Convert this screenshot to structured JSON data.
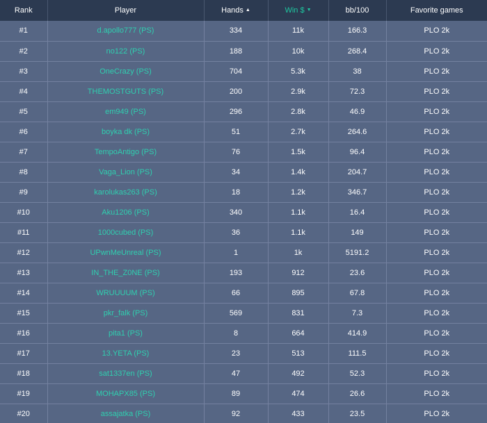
{
  "header": {
    "rank": "Rank",
    "player": "Player",
    "hands": "Hands",
    "hands_sort_icon": "▲",
    "win": "Win $",
    "win_sort_icon": "▼",
    "bb100": "bb/100",
    "favorite_games": "Favorite games"
  },
  "colors": {
    "header_bg": "#2c3a51",
    "row_bg": "#566684",
    "accent": "#1ec8a0",
    "link": "#2fd0b0"
  },
  "rows": [
    {
      "rank": "#1",
      "player": "d.apollo777 (PS)",
      "hands": "334",
      "win": "11k",
      "bb100": "166.3",
      "game": "PLO 2k"
    },
    {
      "rank": "#2",
      "player": "no122 (PS)",
      "hands": "188",
      "win": "10k",
      "bb100": "268.4",
      "game": "PLO 2k"
    },
    {
      "rank": "#3",
      "player": "OneCrazy (PS)",
      "hands": "704",
      "win": "5.3k",
      "bb100": "38",
      "game": "PLO 2k"
    },
    {
      "rank": "#4",
      "player": "THEMOSTGUTS (PS)",
      "hands": "200",
      "win": "2.9k",
      "bb100": "72.3",
      "game": "PLO 2k"
    },
    {
      "rank": "#5",
      "player": "em949 (PS)",
      "hands": "296",
      "win": "2.8k",
      "bb100": "46.9",
      "game": "PLO 2k"
    },
    {
      "rank": "#6",
      "player": "boyka dk (PS)",
      "hands": "51",
      "win": "2.7k",
      "bb100": "264.6",
      "game": "PLO 2k"
    },
    {
      "rank": "#7",
      "player": "TempoAntigo (PS)",
      "hands": "76",
      "win": "1.5k",
      "bb100": "96.4",
      "game": "PLO 2k"
    },
    {
      "rank": "#8",
      "player": "Vaga_Lion (PS)",
      "hands": "34",
      "win": "1.4k",
      "bb100": "204.7",
      "game": "PLO 2k"
    },
    {
      "rank": "#9",
      "player": "karolukas263 (PS)",
      "hands": "18",
      "win": "1.2k",
      "bb100": "346.7",
      "game": "PLO 2k"
    },
    {
      "rank": "#10",
      "player": "Aku1206 (PS)",
      "hands": "340",
      "win": "1.1k",
      "bb100": "16.4",
      "game": "PLO 2k"
    },
    {
      "rank": "#11",
      "player": "1000cubed (PS)",
      "hands": "36",
      "win": "1.1k",
      "bb100": "149",
      "game": "PLO 2k"
    },
    {
      "rank": "#12",
      "player": "UPwnMeUnreal (PS)",
      "hands": "1",
      "win": "1k",
      "bb100": "5191.2",
      "game": "PLO 2k"
    },
    {
      "rank": "#13",
      "player": "IN_THE_Z0NE (PS)",
      "hands": "193",
      "win": "912",
      "bb100": "23.6",
      "game": "PLO 2k"
    },
    {
      "rank": "#14",
      "player": "WRUUUUM (PS)",
      "hands": "66",
      "win": "895",
      "bb100": "67.8",
      "game": "PLO 2k"
    },
    {
      "rank": "#15",
      "player": "pkr_falk (PS)",
      "hands": "569",
      "win": "831",
      "bb100": "7.3",
      "game": "PLO 2k"
    },
    {
      "rank": "#16",
      "player": "pita1 (PS)",
      "hands": "8",
      "win": "664",
      "bb100": "414.9",
      "game": "PLO 2k"
    },
    {
      "rank": "#17",
      "player": "13.YETA (PS)",
      "hands": "23",
      "win": "513",
      "bb100": "111.5",
      "game": "PLO 2k"
    },
    {
      "rank": "#18",
      "player": "sat1337en (PS)",
      "hands": "47",
      "win": "492",
      "bb100": "52.3",
      "game": "PLO 2k"
    },
    {
      "rank": "#19",
      "player": "MOHAPX85 (PS)",
      "hands": "89",
      "win": "474",
      "bb100": "26.6",
      "game": "PLO 2k"
    },
    {
      "rank": "#20",
      "player": "assajatka (PS)",
      "hands": "92",
      "win": "433",
      "bb100": "23.5",
      "game": "PLO 2k"
    }
  ]
}
